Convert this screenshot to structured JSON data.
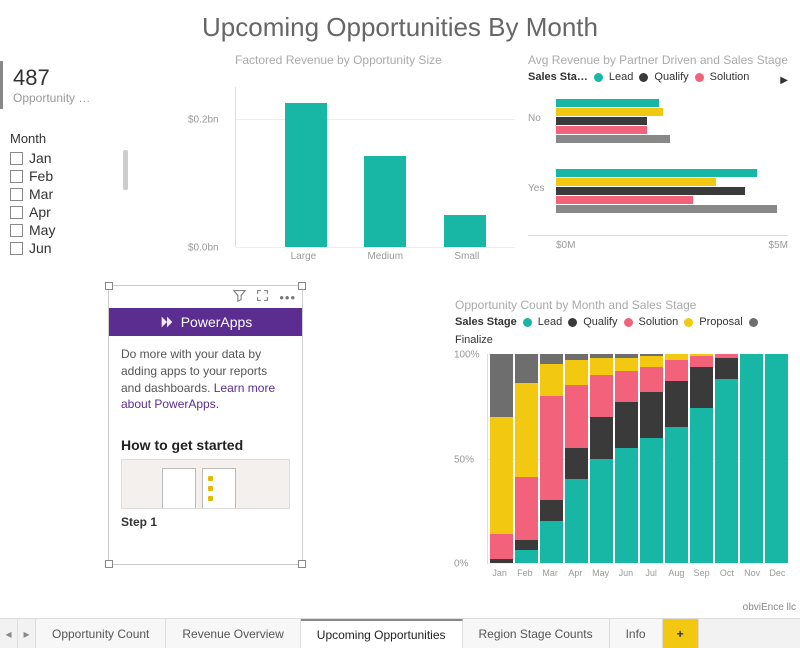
{
  "title": "Upcoming Opportunities By Month",
  "kpi": {
    "value": "487",
    "label": "Opportunity …"
  },
  "slicer": {
    "header": "Month",
    "items": [
      "Jan",
      "Feb",
      "Mar",
      "Apr",
      "May",
      "Jun"
    ]
  },
  "factored": {
    "title": "Factored Revenue by Opportunity Size",
    "yticks": [
      "$0.2bn",
      "$0.0bn"
    ]
  },
  "avgrev": {
    "title": "Avg Revenue by Partner Driven and Sales Stage",
    "legend_label": "Sales Sta…",
    "legend": [
      "Lead",
      "Qualify",
      "Solution"
    ],
    "ycats": [
      "No",
      "Yes"
    ],
    "xticks": [
      "$0M",
      "$5M"
    ]
  },
  "stacked": {
    "title": "Opportunity Count by Month and Sales Stage",
    "legend_label": "Sales Stage",
    "legend": [
      "Lead",
      "Qualify",
      "Solution",
      "Proposal",
      "Finalize"
    ],
    "yticks": [
      "100%",
      "50%",
      "0%"
    ],
    "months": [
      "Jan",
      "Feb",
      "Mar",
      "Apr",
      "May",
      "Jun",
      "Jul",
      "Aug",
      "Sep",
      "Oct",
      "Nov",
      "Dec"
    ]
  },
  "powerapps": {
    "brand": "PowerApps",
    "body_text": "Do more with your data by adding apps to your reports and dashboards. ",
    "link_text": "Learn more about PowerApps.",
    "get_started": "How to get started",
    "step1": "Step 1"
  },
  "attribution": "obviEnce llc",
  "tabs": {
    "items": [
      "Opportunity Count",
      "Revenue Overview",
      "Upcoming Opportunities",
      "Region Stage Counts",
      "Info"
    ],
    "active": 2,
    "add": "+"
  },
  "colors": {
    "lead": "#18b7a5",
    "qualify": "#3a3a3a",
    "solution": "#f2637b",
    "proposal": "#f2c811",
    "finalize": "#6e6e6e"
  },
  "chart_data": [
    {
      "type": "bar",
      "title": "Factored Revenue by Opportunity Size",
      "categories": [
        "Large",
        "Medium",
        "Small"
      ],
      "values": [
        0.27,
        0.17,
        0.06
      ],
      "ylabel": "Revenue ($bn)",
      "ylim": [
        0,
        0.3
      ]
    },
    {
      "type": "bar",
      "orientation": "horizontal",
      "title": "Avg Revenue by Partner Driven and Sales Stage",
      "categories": [
        "No",
        "Yes"
      ],
      "series": [
        {
          "name": "Lead",
          "values": [
            2.7,
            5.3
          ]
        },
        {
          "name": "Proposal",
          "values": [
            2.8,
            4.2
          ]
        },
        {
          "name": "Qualify",
          "values": [
            2.4,
            5.0
          ]
        },
        {
          "name": "Solution",
          "values": [
            2.4,
            3.6
          ]
        },
        {
          "name": "Finalize",
          "values": [
            3.0,
            5.8
          ]
        }
      ],
      "xlabel": "Avg Revenue ($M)",
      "xlim": [
        0,
        6
      ]
    },
    {
      "type": "bar",
      "stacked": "100%",
      "title": "Opportunity Count by Month and Sales Stage",
      "categories": [
        "Jan",
        "Feb",
        "Mar",
        "Apr",
        "May",
        "Jun",
        "Jul",
        "Aug",
        "Sep",
        "Oct",
        "Nov",
        "Dec"
      ],
      "series": [
        {
          "name": "Lead",
          "values": [
            0,
            6,
            20,
            40,
            50,
            55,
            60,
            65,
            74,
            88,
            100,
            100
          ]
        },
        {
          "name": "Qualify",
          "values": [
            2,
            5,
            10,
            15,
            20,
            22,
            22,
            22,
            20,
            10,
            0,
            0
          ]
        },
        {
          "name": "Solution",
          "values": [
            12,
            30,
            50,
            30,
            20,
            15,
            12,
            10,
            5,
            2,
            0,
            0
          ]
        },
        {
          "name": "Proposal",
          "values": [
            56,
            45,
            15,
            12,
            8,
            6,
            5,
            3,
            1,
            0,
            0,
            0
          ]
        },
        {
          "name": "Finalize",
          "values": [
            30,
            14,
            5,
            3,
            2,
            2,
            1,
            0,
            0,
            0,
            0,
            0
          ]
        }
      ],
      "ylabel": "% of Opportunity Count",
      "ylim": [
        0,
        100
      ]
    }
  ]
}
